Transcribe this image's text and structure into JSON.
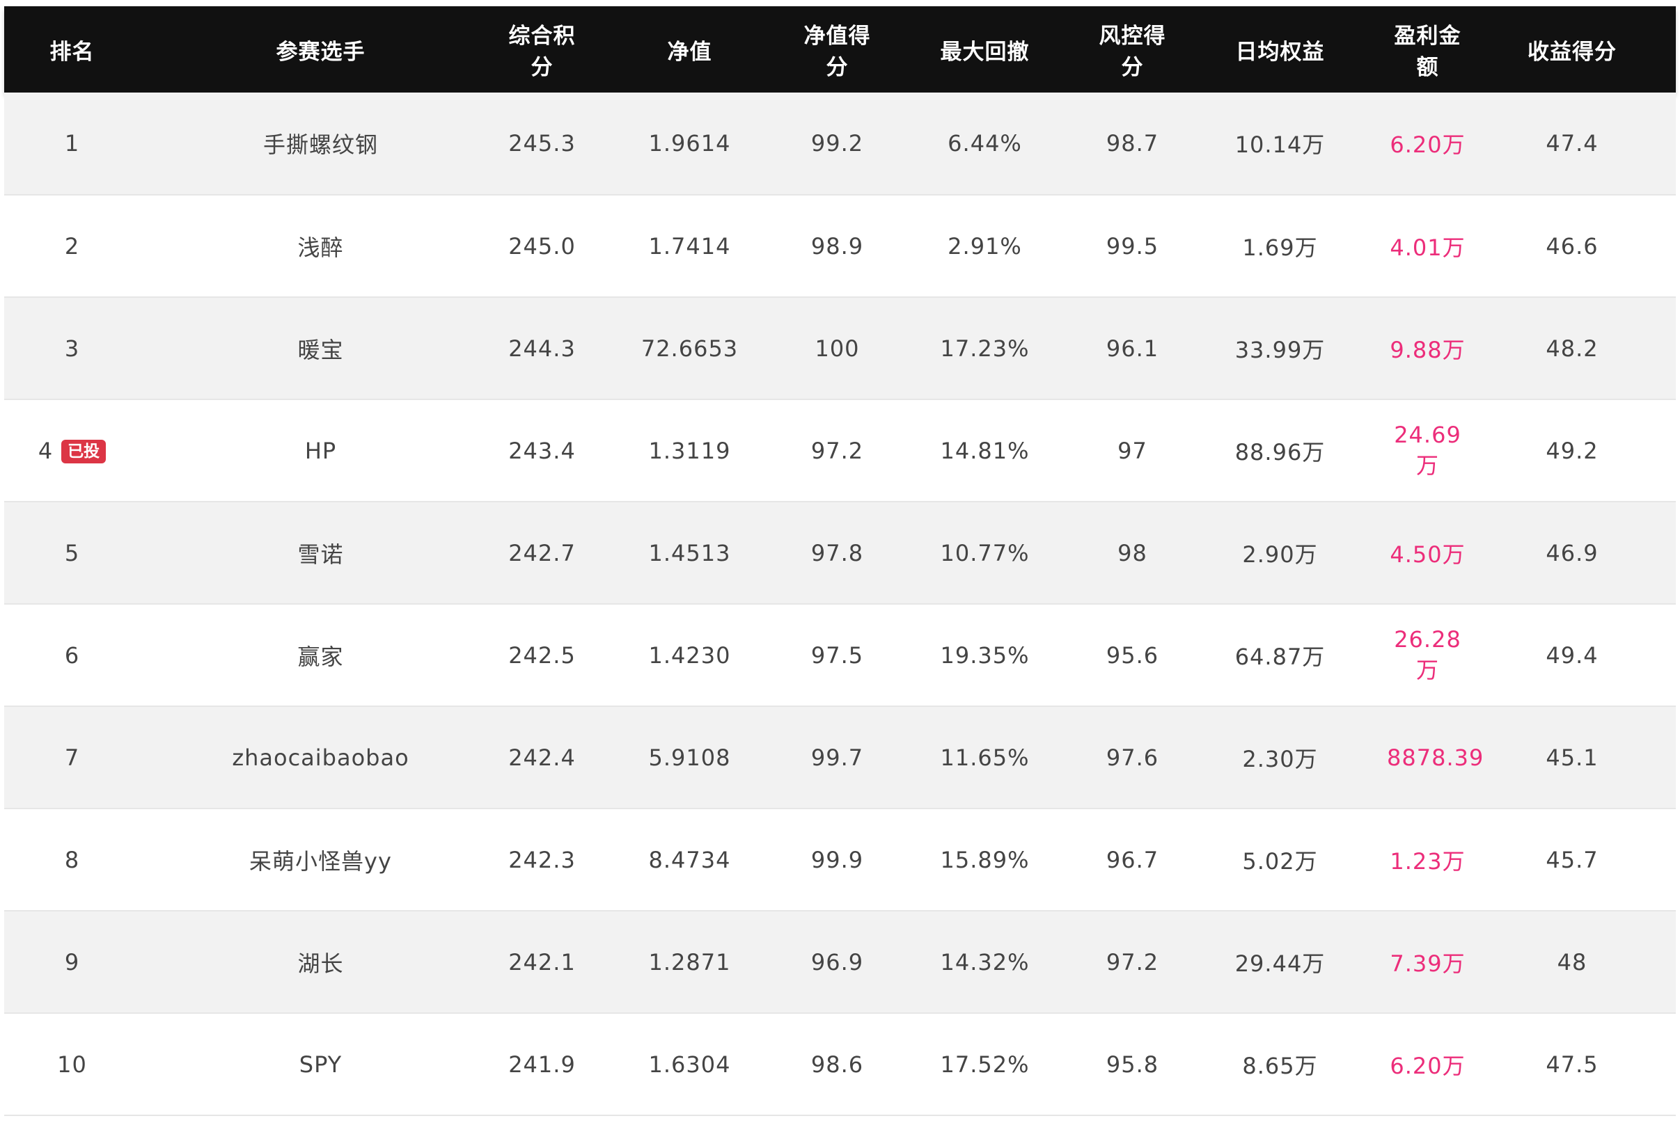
{
  "headers": [
    "排名",
    "参赛选手",
    "综合积分",
    "净值",
    "净值得分",
    "最大回撤",
    "风控得分",
    "日均权益",
    "盈利金额",
    "收益得分"
  ],
  "colors": {
    "header_bg": "#111111",
    "row_alt": "#f2f2f2",
    "profit_text": "#ec2d7a",
    "badge_bg": "#dc3545"
  },
  "rows": [
    {
      "rank": "1",
      "player": "手撕螺纹钢",
      "total": "245.3",
      "nav": "1.9614",
      "nav_score": "99.2",
      "max_dd": "6.44%",
      "risk_score": "98.7",
      "avg_equity": "10.14万",
      "profit": "6.20万",
      "return_score": "47.4"
    },
    {
      "rank": "2",
      "player": "浅醉",
      "total": "245.0",
      "nav": "1.7414",
      "nav_score": "98.9",
      "max_dd": "2.91%",
      "risk_score": "99.5",
      "avg_equity": "1.69万",
      "profit": "4.01万",
      "return_score": "46.6"
    },
    {
      "rank": "3",
      "player": "暖宝",
      "total": "244.3",
      "nav": "72.6653",
      "nav_score": "100",
      "max_dd": "17.23%",
      "risk_score": "96.1",
      "avg_equity": "33.99万",
      "profit": "9.88万",
      "return_score": "48.2"
    },
    {
      "rank": "4",
      "badge": "已投",
      "player": "HP",
      "total": "243.4",
      "nav": "1.3119",
      "nav_score": "97.2",
      "max_dd": "14.81%",
      "risk_score": "97",
      "avg_equity": "88.96万",
      "profit": "24.69万",
      "return_score": "49.2"
    },
    {
      "rank": "5",
      "player": "雪诺",
      "total": "242.7",
      "nav": "1.4513",
      "nav_score": "97.8",
      "max_dd": "10.77%",
      "risk_score": "98",
      "avg_equity": "2.90万",
      "profit": "4.50万",
      "return_score": "46.9"
    },
    {
      "rank": "6",
      "player": "赢家",
      "total": "242.5",
      "nav": "1.4230",
      "nav_score": "97.5",
      "max_dd": "19.35%",
      "risk_score": "95.6",
      "avg_equity": "64.87万",
      "profit": "26.28万",
      "return_score": "49.4"
    },
    {
      "rank": "7",
      "player": "zhaocaibaobao",
      "total": "242.4",
      "nav": "5.9108",
      "nav_score": "99.7",
      "max_dd": "11.65%",
      "risk_score": "97.6",
      "avg_equity": "2.30万",
      "profit": "8878.39",
      "return_score": "45.1"
    },
    {
      "rank": "8",
      "player": "呆萌小怪兽yy",
      "total": "242.3",
      "nav": "8.4734",
      "nav_score": "99.9",
      "max_dd": "15.89%",
      "risk_score": "96.7",
      "avg_equity": "5.02万",
      "profit": "1.23万",
      "return_score": "45.7"
    },
    {
      "rank": "9",
      "player": "湖长",
      "total": "242.1",
      "nav": "1.2871",
      "nav_score": "96.9",
      "max_dd": "14.32%",
      "risk_score": "97.2",
      "avg_equity": "29.44万",
      "profit": "7.39万",
      "return_score": "48"
    },
    {
      "rank": "10",
      "player": "SPY",
      "total": "241.9",
      "nav": "1.6304",
      "nav_score": "98.6",
      "max_dd": "17.52%",
      "risk_score": "95.8",
      "avg_equity": "8.65万",
      "profit": "6.20万",
      "return_score": "47.5"
    }
  ]
}
